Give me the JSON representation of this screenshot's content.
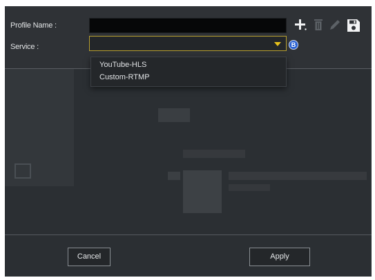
{
  "form": {
    "profile_name_label": "Profile Name :",
    "profile_name_value": "",
    "service_label": "Service :",
    "service_selected": ""
  },
  "info_badge": "B",
  "toolbar": {
    "icons": [
      "plus-icon",
      "trash-icon",
      "pencil-icon",
      "save-icon"
    ]
  },
  "dropdown": {
    "options": [
      "YouTube-HLS",
      "Custom-RTMP"
    ]
  },
  "footer": {
    "cancel_label": "Cancel",
    "apply_label": "Apply"
  },
  "colors": {
    "panel_background": "#2b2f33",
    "input_background": "#060708",
    "select_border": "#b8a030",
    "caret": "#e8c21c",
    "info_badge": "#2a62d4",
    "text": "#e2e4e6"
  }
}
